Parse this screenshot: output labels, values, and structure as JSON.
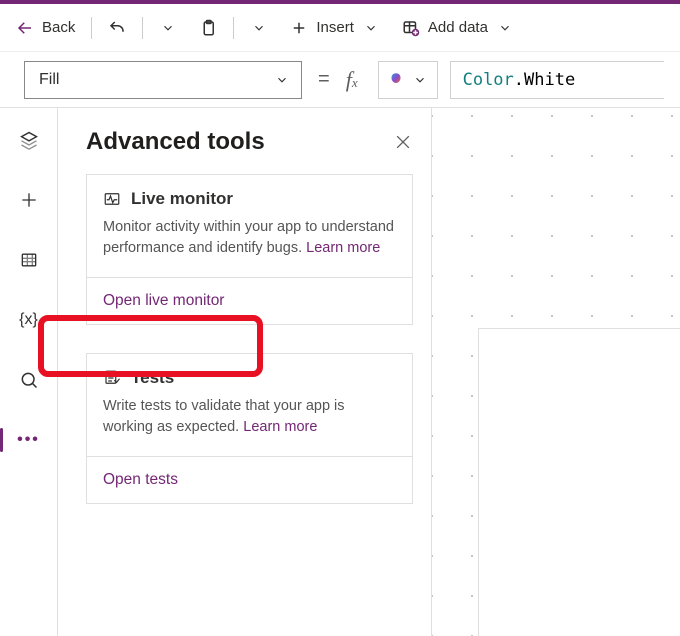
{
  "toolbar": {
    "back_label": "Back",
    "insert_label": "Insert",
    "add_data_label": "Add data"
  },
  "formula_bar": {
    "property": "Fill",
    "tokens": {
      "color": "Color",
      "dot": ".",
      "white": "White"
    }
  },
  "leftrail": {
    "items": [
      {
        "name": "tree-view-icon"
      },
      {
        "name": "insert-icon"
      },
      {
        "name": "data-icon"
      },
      {
        "name": "variables-icon"
      },
      {
        "name": "search-icon"
      },
      {
        "name": "advanced-tools-icon"
      }
    ],
    "selected": "advanced-tools-icon"
  },
  "panel": {
    "title": "Advanced tools",
    "cards": [
      {
        "title": "Live monitor",
        "description": "Monitor activity within your app to understand performance and identify bugs.",
        "learn_more": "Learn more",
        "action": "Open live monitor"
      },
      {
        "title": "Tests",
        "description": "Write tests to validate that your app is working as expected.",
        "learn_more": "Learn more",
        "action": "Open tests"
      }
    ]
  },
  "highlight": {
    "target": "open-live-monitor-button"
  }
}
